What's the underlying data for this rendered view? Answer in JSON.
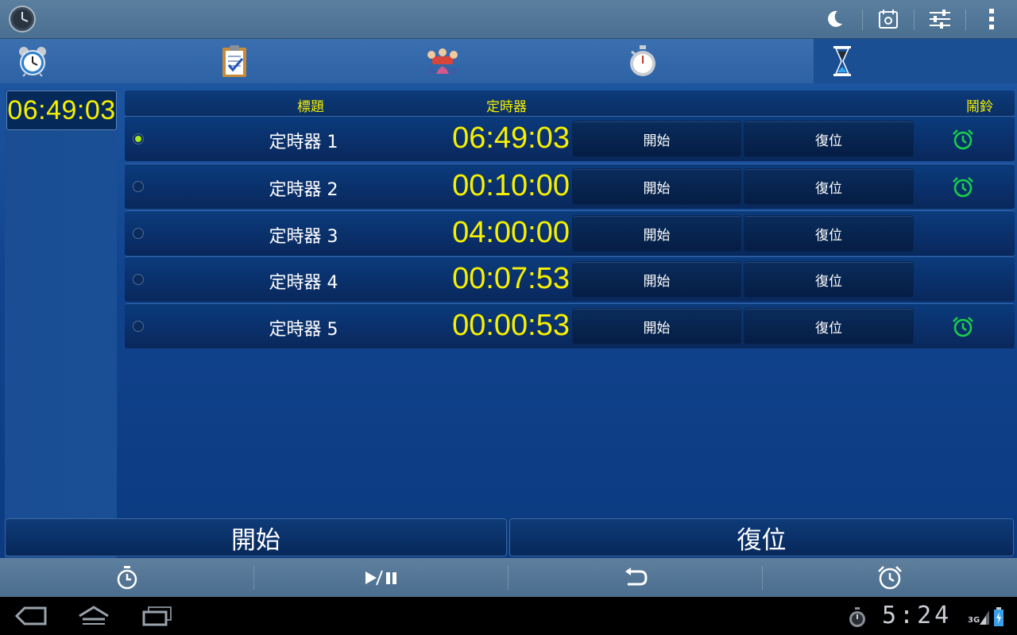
{
  "tabs": [
    {
      "name": "alarm-clock",
      "active": false
    },
    {
      "name": "checklist",
      "active": false
    },
    {
      "name": "group",
      "active": false
    },
    {
      "name": "stopwatch",
      "active": false
    },
    {
      "name": "hourglass",
      "active": true
    }
  ],
  "side_time": "06:49:03",
  "header": {
    "title_col": "標題",
    "timer_col": "定時器",
    "alarm_col": "鬧鈴"
  },
  "timers": [
    {
      "label": "定時器 1",
      "time": "06:49:03",
      "start": "開始",
      "reset": "復位",
      "selected": true,
      "alarm": true
    },
    {
      "label": "定時器 2",
      "time": "00:10:00",
      "start": "開始",
      "reset": "復位",
      "selected": false,
      "alarm": true
    },
    {
      "label": "定時器 3",
      "time": "04:00:00",
      "start": "開始",
      "reset": "復位",
      "selected": false,
      "alarm": false
    },
    {
      "label": "定時器 4",
      "time": "00:07:53",
      "start": "開始",
      "reset": "復位",
      "selected": false,
      "alarm": false
    },
    {
      "label": "定時器 5",
      "time": "00:00:53",
      "start": "開始",
      "reset": "復位",
      "selected": false,
      "alarm": true
    }
  ],
  "bottom": {
    "start_all": "開始",
    "reset_all": "復位"
  },
  "system": {
    "clock": "5:24",
    "network": "3G"
  },
  "colors": {
    "accent_yellow": "#f7f000",
    "alarm_green": "#19d14a",
    "radio_on": "#a8e81c"
  }
}
